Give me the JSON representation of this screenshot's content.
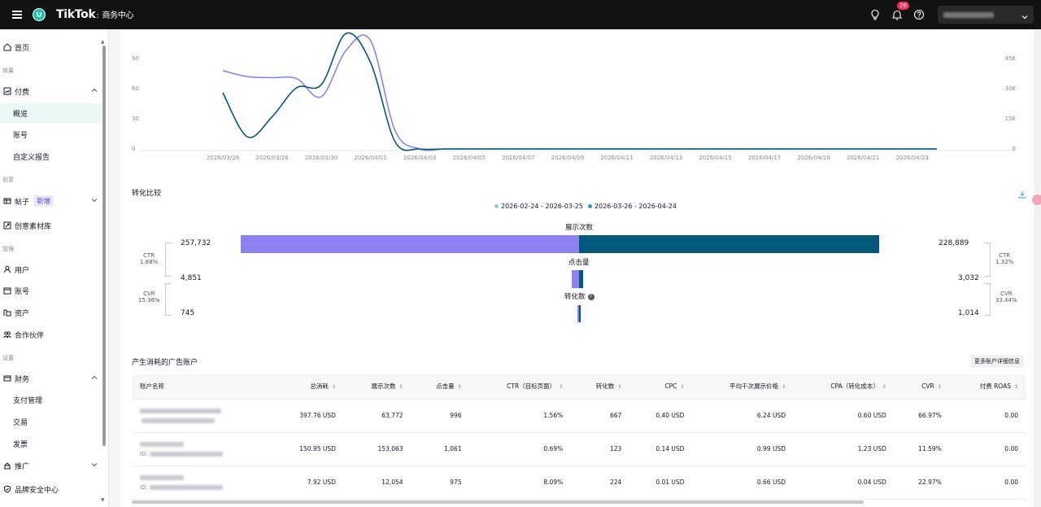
{
  "topbar": {
    "avatar_letter": "U",
    "brand": "TikTok",
    "brand_suffix": "商务中心",
    "notification_count": "28"
  },
  "sidebar": {
    "items": [
      {
        "label": "首页",
        "icon": "home-icon"
      },
      {
        "section": "效果"
      },
      {
        "label": "付费",
        "icon": "chart-icon",
        "expanded": true
      },
      {
        "label": "概览",
        "sub": true,
        "active": true
      },
      {
        "label": "账号",
        "sub": true
      },
      {
        "label": "自定义报告",
        "sub": true
      },
      {
        "section": "创意"
      },
      {
        "label": "帖子",
        "icon": "post-icon",
        "tag": "新增"
      },
      {
        "label": "创意素材库",
        "icon": "library-icon"
      },
      {
        "section": "管理"
      },
      {
        "label": "用户",
        "icon": "user-icon"
      },
      {
        "label": "账号",
        "icon": "account-icon"
      },
      {
        "label": "资产",
        "icon": "asset-icon"
      },
      {
        "label": "合作伙伴",
        "icon": "partner-icon"
      },
      {
        "section": "设置"
      },
      {
        "label": "财务",
        "icon": "finance-icon",
        "expanded": true
      },
      {
        "label": "支付管理",
        "sub": true
      },
      {
        "label": "交易",
        "sub": true
      },
      {
        "label": "发票",
        "sub": true
      },
      {
        "label": "推广",
        "icon": "promote-icon"
      },
      {
        "label": "品牌安全中心",
        "icon": "shield-icon"
      }
    ]
  },
  "colors": {
    "series_prev": "#8c82f2",
    "series_curr": "#00587c",
    "accent": "#21c3a8"
  },
  "chart_data": {
    "type": "line",
    "x": [
      "2026/03/26",
      "2026/03/27",
      "2026/03/28",
      "2026/03/29",
      "2026/03/30",
      "2026/03/31",
      "2026/04/01",
      "2026/04/02",
      "2026/04/03",
      "2026/04/04",
      "2026/04/05",
      "2026/04/06",
      "2026/04/07",
      "2026/04/08",
      "2026/04/09",
      "2026/04/10",
      "2026/04/11",
      "2026/04/12",
      "2026/04/13",
      "2026/04/14",
      "2026/04/15",
      "2026/04/16",
      "2026/04/17",
      "2026/04/18",
      "2026/04/19",
      "2026/04/20",
      "2026/04/21",
      "2026/04/22",
      "2026/04/23",
      "2026/04/24"
    ],
    "x_tick_labels": [
      "2026/03/26",
      "2026/03/28",
      "2026/03/30",
      "2026/04/01",
      "2026/04/03",
      "2026/04/05",
      "2026/04/07",
      "2026/04/09",
      "2026/04/11",
      "2026/04/13",
      "2026/04/15",
      "2026/04/17",
      "2026/04/19",
      "2026/04/21",
      "2026/04/23"
    ],
    "y_left_ticks": [
      "0",
      "30",
      "60",
      "90"
    ],
    "y_right_ticks": [
      "0",
      "15K",
      "30K",
      "45K"
    ],
    "y_left_lim": [
      0,
      120
    ],
    "y_right_lim": [
      0,
      60000
    ],
    "series": [
      {
        "axis": "left",
        "values": [
          78,
          72,
          71,
          70,
          52,
          98,
          108,
          18,
          0,
          0,
          0,
          0,
          0,
          0,
          0,
          0,
          0,
          0,
          0,
          0,
          0,
          0,
          0,
          0,
          0,
          0,
          0,
          0,
          0,
          0
        ]
      },
      {
        "axis": "right",
        "values": [
          28000,
          6000,
          16000,
          30500,
          32000,
          57500,
          43000,
          3500,
          0,
          0,
          0,
          0,
          0,
          0,
          0,
          0,
          0,
          0,
          0,
          0,
          0,
          0,
          0,
          0,
          0,
          0,
          0,
          0,
          0,
          0
        ]
      }
    ]
  },
  "conversion": {
    "title": "转化比较",
    "legend": [
      "2026-02-24 - 2026-03-25",
      "2026-03-26 - 2026-04-24"
    ],
    "stages": [
      "展示次数",
      "点击量",
      "转化数"
    ],
    "left": {
      "impressions": "257,732",
      "clicks": "4,851",
      "conversions": "745",
      "ctr_label": "CTR",
      "ctr": "1.88%",
      "cvr_label": "CVR",
      "cvr": "15.36%"
    },
    "right": {
      "impressions": "228,889",
      "clicks": "3,032",
      "conversions": "1,014",
      "ctr_label": "CTR",
      "ctr": "1.32%",
      "cvr_label": "CVR",
      "cvr": "33.44%"
    },
    "values": {
      "impressions": [
        257732,
        228889
      ],
      "clicks": [
        4851,
        3032
      ],
      "conversions": [
        745,
        1014
      ]
    }
  },
  "accounts": {
    "title": "产生消耗的广告账户",
    "more_button": "更多账户详细信息",
    "columns": [
      "账户名称",
      "总消耗",
      "展示次数",
      "点击量",
      "CTR（目标页面）",
      "转化数",
      "CPC",
      "平均千次展示价格",
      "CPA（转化成本）",
      "CVR",
      "付费 ROAS"
    ],
    "rows": [
      {
        "id_label": "",
        "cells": [
          "397.76 USD",
          "63,772",
          "996",
          "1.56%",
          "667",
          "0.40 USD",
          "6.24 USD",
          "0.60 USD",
          "66.97%",
          "0.00"
        ]
      },
      {
        "id_label": "ID:",
        "cells": [
          "150.95 USD",
          "153,063",
          "1,061",
          "0.69%",
          "123",
          "0.14 USD",
          "0.99 USD",
          "1.23 USD",
          "11.59%",
          "0.00"
        ]
      },
      {
        "id_label": "ID:",
        "cells": [
          "7.92 USD",
          "12,054",
          "975",
          "8.09%",
          "224",
          "0.01 USD",
          "0.66 USD",
          "0.04 USD",
          "22.97%",
          "0.00"
        ]
      }
    ]
  }
}
